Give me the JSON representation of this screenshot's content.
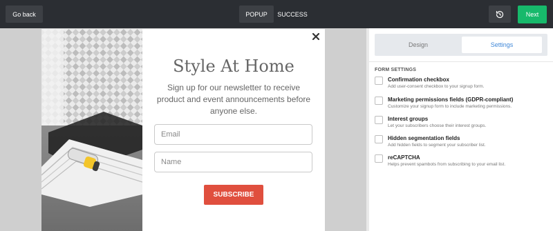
{
  "topbar": {
    "go_back": "Go back",
    "tabs": [
      {
        "label": "POPUP",
        "active": true
      },
      {
        "label": "SUCCESS",
        "active": false
      }
    ],
    "undo_icon": "history-icon",
    "next": "Next"
  },
  "popup": {
    "headline": "Style At Home",
    "subtext": "Sign up for our newsletter to receive product and event announcements before anyone else.",
    "email_placeholder": "Email",
    "name_placeholder": "Name",
    "subscribe": "SUBSCRIBE",
    "close_icon": "close-icon"
  },
  "panel": {
    "tabs": [
      {
        "label": "Design",
        "active": false
      },
      {
        "label": "Settings",
        "active": true
      }
    ],
    "section_title": "FORM SETTINGS",
    "options": [
      {
        "label": "Confirmation checkbox",
        "desc": "Add user-consent checkbox to your signup form."
      },
      {
        "label": "Marketing permissions fields (GDPR-compliant)",
        "desc": "Customize your signup form to include marketing permissions."
      },
      {
        "label": "Interest groups",
        "desc": "Let your subscribers choose their interest groups."
      },
      {
        "label": "Hidden segmentation fields",
        "desc": "Add hidden fields to segment your subscriber list."
      },
      {
        "label": "reCAPTCHA",
        "desc": "Helps prevent spambots from subscribing to your email list."
      }
    ]
  },
  "colors": {
    "topbar": "#2b2e33",
    "next": "#17b96b",
    "subscribe": "#e04f3e",
    "settings_active": "#3f87d8"
  }
}
